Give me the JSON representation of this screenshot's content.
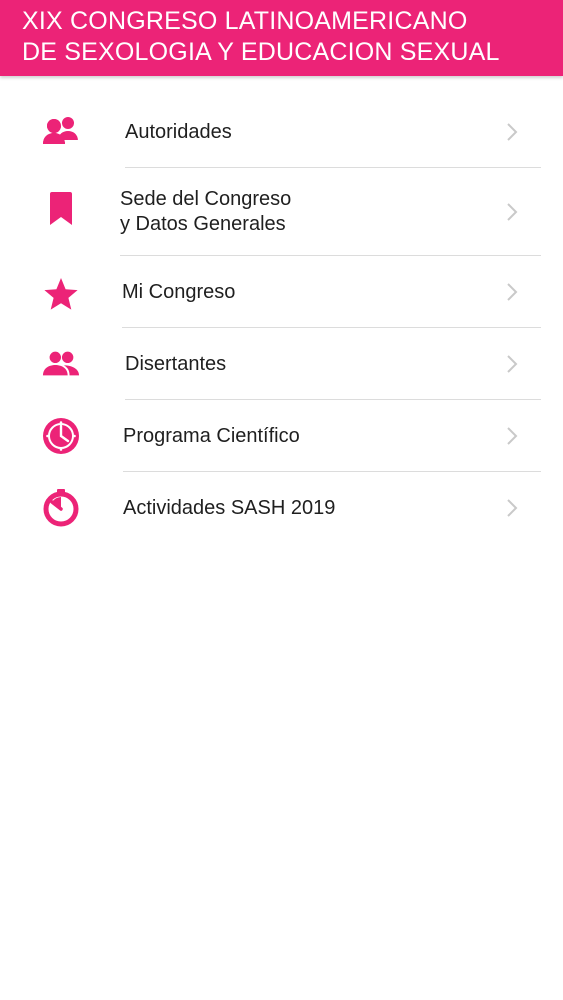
{
  "header": {
    "title": "XIX CONGRESO LATINOAMERICANO\nDE SEXOLOGIA Y EDUCACION SEXUAL"
  },
  "menu": {
    "items": [
      {
        "label": "Autoridades",
        "icon": "people-icon"
      },
      {
        "label": "Sede del Congreso\ny Datos Generales",
        "icon": "bookmark-icon"
      },
      {
        "label": "Mi Congreso",
        "icon": "star-icon"
      },
      {
        "label": "Disertantes",
        "icon": "group-icon"
      },
      {
        "label": "Programa Científico",
        "icon": "clock-icon"
      },
      {
        "label": "Actividades SASH 2019",
        "icon": "timer-icon"
      }
    ]
  },
  "colors": {
    "accent": "#ec2377",
    "text": "#1f1f1f",
    "divider": "#dcdcdc",
    "chevron": "#c9c9c9"
  }
}
